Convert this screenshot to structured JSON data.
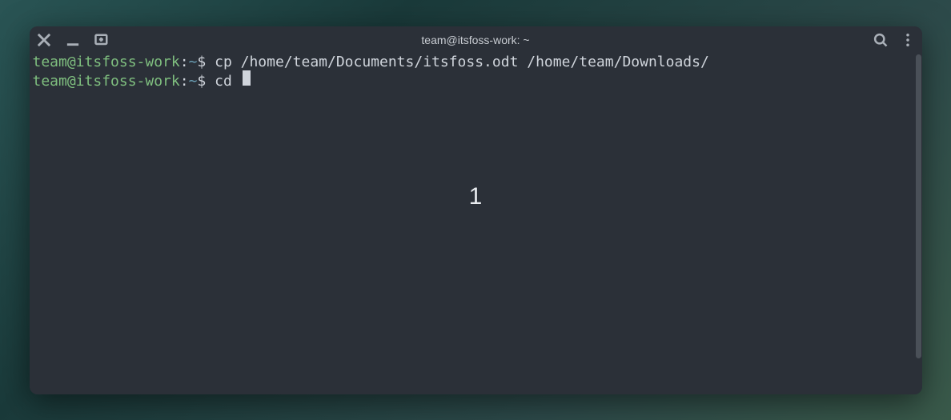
{
  "window": {
    "title": "team@itsfoss-work: ~"
  },
  "terminal": {
    "lines": [
      {
        "user_host": "team@itsfoss-work",
        "colon": ":",
        "path": "~",
        "dollar": "$ ",
        "command": "cp /home/team/Documents/itsfoss.odt /home/team/Downloads/"
      },
      {
        "user_host": "team@itsfoss-work",
        "colon": ":",
        "path": "~",
        "dollar": "$ ",
        "command": "cd "
      }
    ],
    "center_overlay": "1"
  }
}
